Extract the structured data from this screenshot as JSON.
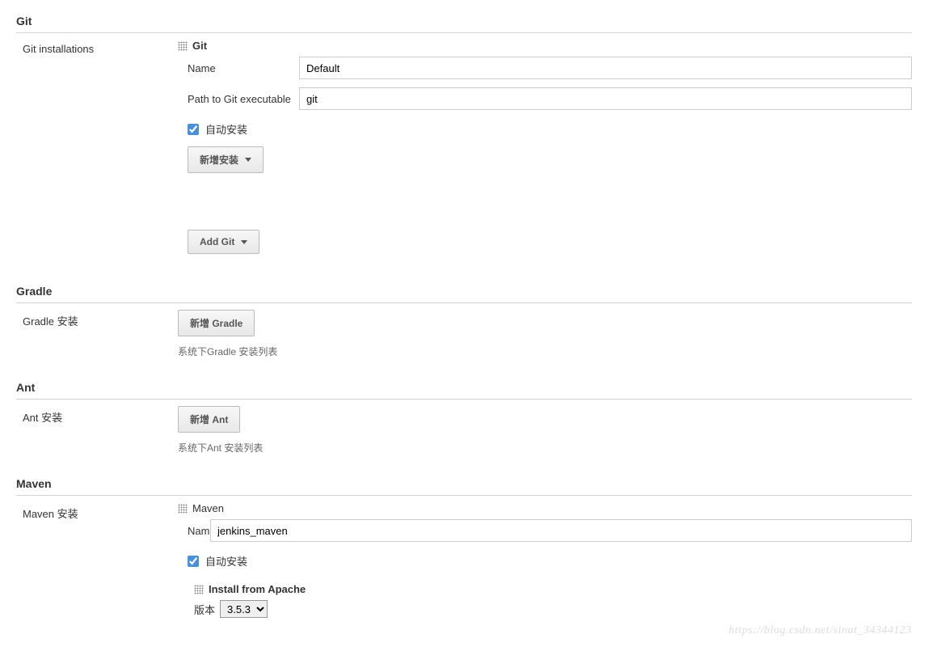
{
  "git": {
    "header": "Git",
    "installations_label": "Git installations",
    "tool_title": "Git",
    "name_label": "Name",
    "name_value": "Default",
    "path_label": "Path to Git executable",
    "path_value": "git",
    "auto_install_label": "自动安装",
    "auto_install_checked": true,
    "add_install_btn": "新增安装",
    "add_git_btn": "Add Git"
  },
  "gradle": {
    "header": "Gradle",
    "installations_label": "Gradle 安装",
    "add_btn": "新增 Gradle",
    "hint": "系统下Gradle 安装列表"
  },
  "ant": {
    "header": "Ant",
    "installations_label": "Ant 安装",
    "add_btn": "新增 Ant",
    "hint": "系统下Ant 安装列表"
  },
  "maven": {
    "header": "Maven",
    "installations_label": "Maven 安装",
    "tool_title": "Maven",
    "name_label": "Name",
    "name_value": "jenkins_maven",
    "auto_install_label": "自动安装",
    "auto_install_checked": true,
    "install_from_apache": "Install from Apache",
    "version_label": "版本",
    "version_value": "3.5.3"
  },
  "watermark": "https://blog.csdn.net/sinat_34344123"
}
